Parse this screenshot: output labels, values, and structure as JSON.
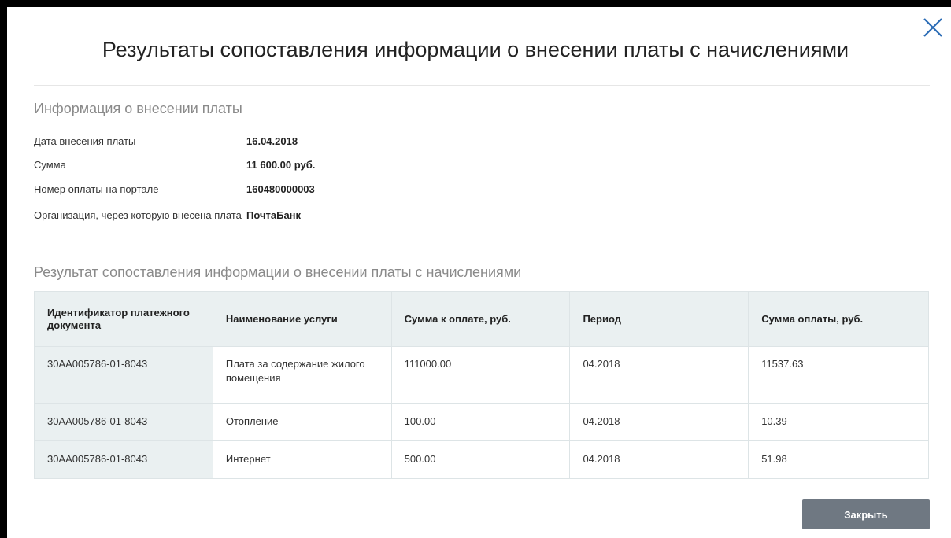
{
  "dialog": {
    "title": "Результаты сопоставления информации о внесении платы с начислениями",
    "close_icon": "close-icon"
  },
  "payment_info": {
    "heading": "Информация о внесении платы",
    "fields": [
      {
        "label": "Дата внесения платы",
        "value": "16.04.2018"
      },
      {
        "label": "Сумма",
        "value": "11 600.00 руб."
      },
      {
        "label": "Номер оплаты на портале",
        "value": "160480000003"
      },
      {
        "label": "Организация, через которую внесена плата",
        "value": "ПочтаБанк"
      }
    ]
  },
  "results": {
    "heading": "Результат сопоставления информации о внесении платы с начислениями",
    "columns": [
      "Идентификатор платежного документа",
      "Наименование услуги",
      "Сумма к оплате, руб.",
      "Период",
      "Сумма оплаты, руб."
    ],
    "rows": [
      [
        "30АА005786-01-8043",
        "Плата за содержание жилого помещения",
        "111000.00",
        "04.2018",
        "11537.63"
      ],
      [
        "30АА005786-01-8043",
        "Отопление",
        "100.00",
        "04.2018",
        "10.39"
      ],
      [
        "30АА005786-01-8043",
        "Интернет",
        "500.00",
        "04.2018",
        "51.98"
      ]
    ]
  },
  "footer": {
    "close_label": "Закрыть"
  },
  "colors": {
    "header_bg": "#eaf0f1",
    "button_bg": "#6f7882",
    "close_icon": "#2a6bb5"
  }
}
